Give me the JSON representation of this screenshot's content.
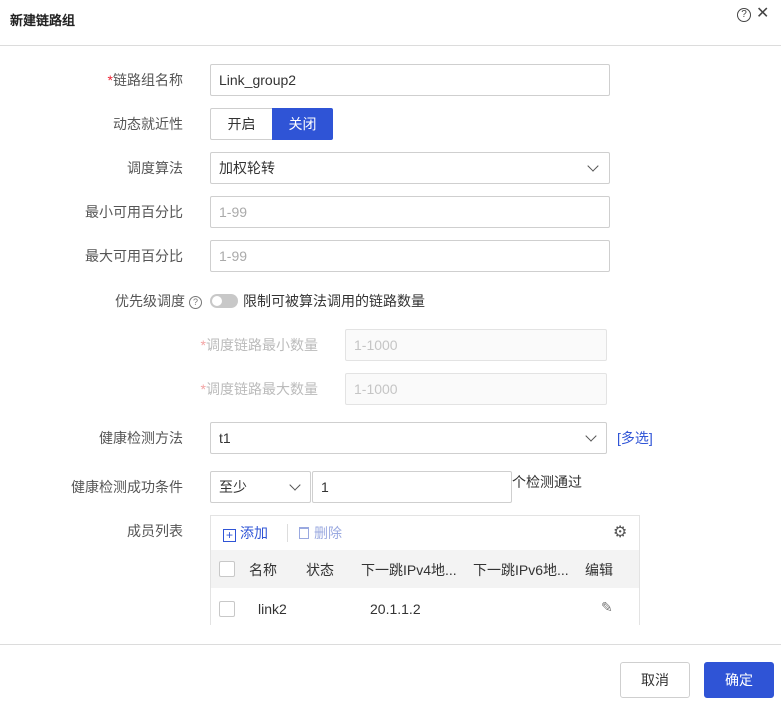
{
  "dialog": {
    "title": "新建链路组",
    "help_glyph": "?",
    "close_glyph": "✕"
  },
  "form": {
    "name_label": "链路组名称",
    "name_required": "*",
    "name_value": "Link_group2",
    "proximity_label": "动态就近性",
    "proximity_on": "开启",
    "proximity_off": "关闭",
    "proximity_selected": "关闭",
    "algorithm_label": "调度算法",
    "algorithm_value": "加权轮转",
    "min_pct_label": "最小可用百分比",
    "min_pct_placeholder": "1-99",
    "max_pct_label": "最大可用百分比",
    "max_pct_placeholder": "1-99",
    "priority_label": "优先级调度",
    "priority_help": "?",
    "priority_toggle_text": "限制可被算法调用的链路数量",
    "priority_enabled": false,
    "min_links_label": "调度链路最小数量",
    "min_links_placeholder": "1-1000",
    "max_links_label": "调度链路最大数量",
    "max_links_placeholder": "1-1000",
    "health_method_label": "健康检测方法",
    "health_method_value": "t1",
    "health_method_clear": "✕",
    "multi_select_link": "[多选]",
    "health_cond_label": "健康检测成功条件",
    "health_cond_select": "至少",
    "health_cond_count": "1",
    "health_cond_suffix": "个检测通过",
    "members_label": "成员列表"
  },
  "members": {
    "add_label": "添加",
    "delete_label": "删除",
    "settings_icon": "gear-icon",
    "columns": [
      "名称",
      "状态",
      "下一跳IPv4地...",
      "下一跳IPv6地...",
      "编辑"
    ],
    "rows": [
      {
        "name": "link2",
        "status": "",
        "ipv4": "20.1.1.2",
        "ipv6": ""
      }
    ]
  },
  "footer": {
    "cancel_label": "取消",
    "ok_label": "确定"
  },
  "colors": {
    "accent": "#2f54d6",
    "required": "#e23",
    "border": "#cfcfcf"
  }
}
